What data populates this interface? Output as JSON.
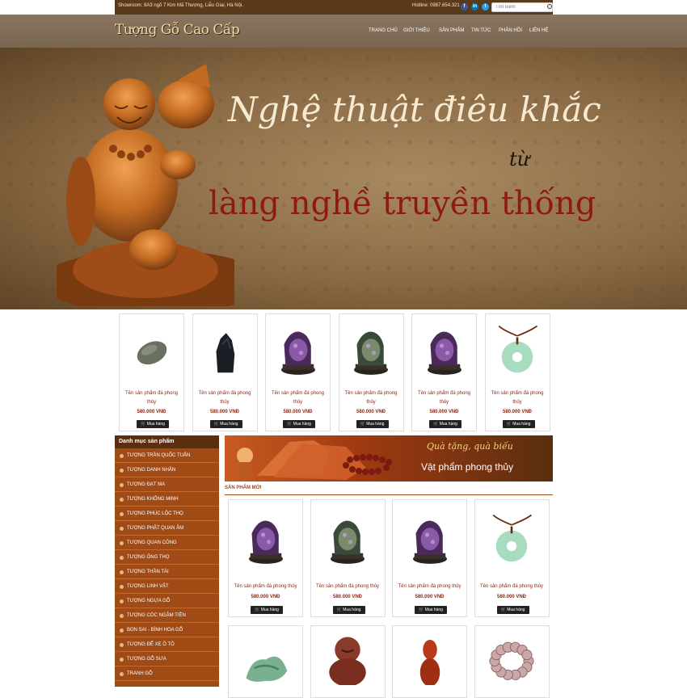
{
  "topbar": {
    "address": "Showroom: 8A3 ngõ 7 Kim Mã Thượng, Liễu Giai, Hà Nội.",
    "hotline": "Hotline: 0987.654.321",
    "search_placeholder": "Tìm kiếm",
    "social": [
      {
        "icon": "facebook-icon",
        "glyph": "f",
        "color": "#3b5998"
      },
      {
        "icon": "linkedin-icon",
        "glyph": "in",
        "color": "#0077b5"
      },
      {
        "icon": "twitter-icon",
        "glyph": "t",
        "color": "#1da1f2"
      }
    ]
  },
  "header": {
    "logo": "Tượng Gỗ Cao Cấp",
    "nav": [
      "TRANG CHỦ",
      "GIỚI THIỆU",
      "SẢN PHẨM",
      "TIN TỨC",
      "PHẢN HỒI",
      "LIÊN HỆ"
    ]
  },
  "banner": {
    "line1": "Nghệ thuật điêu khắc",
    "line2": "từ",
    "line3": "làng nghề truyền thống"
  },
  "carousel": {
    "items": [
      {
        "name": "Tên sản phẩm đá phong thủy",
        "price": "580.000 VNĐ",
        "buy": "Mua hàng",
        "kind": "stone-grey"
      },
      {
        "name": "Tên sản phẩm đá phong thủy",
        "price": "580.000 VNĐ",
        "buy": "Mua hàng",
        "kind": "stone-black"
      },
      {
        "name": "Tên sản phẩm đá phong thủy",
        "price": "580.000 VNĐ",
        "buy": "Mua hàng",
        "kind": "amethyst"
      },
      {
        "name": "Tên sản phẩm đá phong thủy",
        "price": "580.000 VNĐ",
        "buy": "Mua hàng",
        "kind": "amethyst-green"
      },
      {
        "name": "Tên sản phẩm đá phong thủy",
        "price": "580.000 VNĐ",
        "buy": "Mua hàng",
        "kind": "amethyst"
      },
      {
        "name": "Tên sản phẩm đá phong thủy",
        "price": "580.000 VNĐ",
        "buy": "Mua hàng",
        "kind": "jade-pendant"
      }
    ]
  },
  "sidebar": {
    "title": "Danh mục sản phẩm",
    "items": [
      "TƯỢNG TRẦN QUỐC TUẤN",
      "TƯỢNG DANH NHÂN",
      "TƯỢNG ĐẠT MA",
      "TƯỢNG KHỔNG MINH",
      "TƯỢNG PHÚC LỘC THỌ",
      "TƯỢNG PHẬT QUAN ÂM",
      "TƯỢNG QUAN CÔNG",
      "TƯỢNG ÔNG THỌ",
      "TƯỢNG THẦN TÀI",
      "TƯỢNG LINH VẬT",
      "TƯỢNG NGỰA GỖ",
      "TƯỢNG CÓC NGẬM TIỀN",
      "BON SAI - BÌNH HOA GỖ",
      "TƯỢNG ĐỂ XE Ô TÔ",
      "TƯỢNG GỖ SƯA",
      "TRANH GỖ"
    ]
  },
  "promo": {
    "line1": "Quà tặng, quà biếu",
    "line2": "Vật phẩm phong thủy"
  },
  "new_products": {
    "title": "SẢN PHẨM MỚI",
    "row1": [
      {
        "name": "Tên sản phẩm đá phong thủy",
        "price": "580.000 VNĐ",
        "buy": "Mua hàng",
        "kind": "amethyst"
      },
      {
        "name": "Tên sản phẩm đá phong thủy",
        "price": "580.000 VNĐ",
        "buy": "Mua hàng",
        "kind": "amethyst-green"
      },
      {
        "name": "Tên sản phẩm đá phong thủy",
        "price": "580.000 VNĐ",
        "buy": "Mua hàng",
        "kind": "amethyst"
      },
      {
        "name": "Tên sản phẩm đá phong thủy",
        "price": "580.000 VNĐ",
        "buy": "Mua hàng",
        "kind": "jade-pendant"
      }
    ],
    "row2": [
      {
        "kind": "jade-carving"
      },
      {
        "kind": "red-buddha"
      },
      {
        "kind": "red-figure"
      },
      {
        "kind": "crystal-beads"
      }
    ]
  }
}
